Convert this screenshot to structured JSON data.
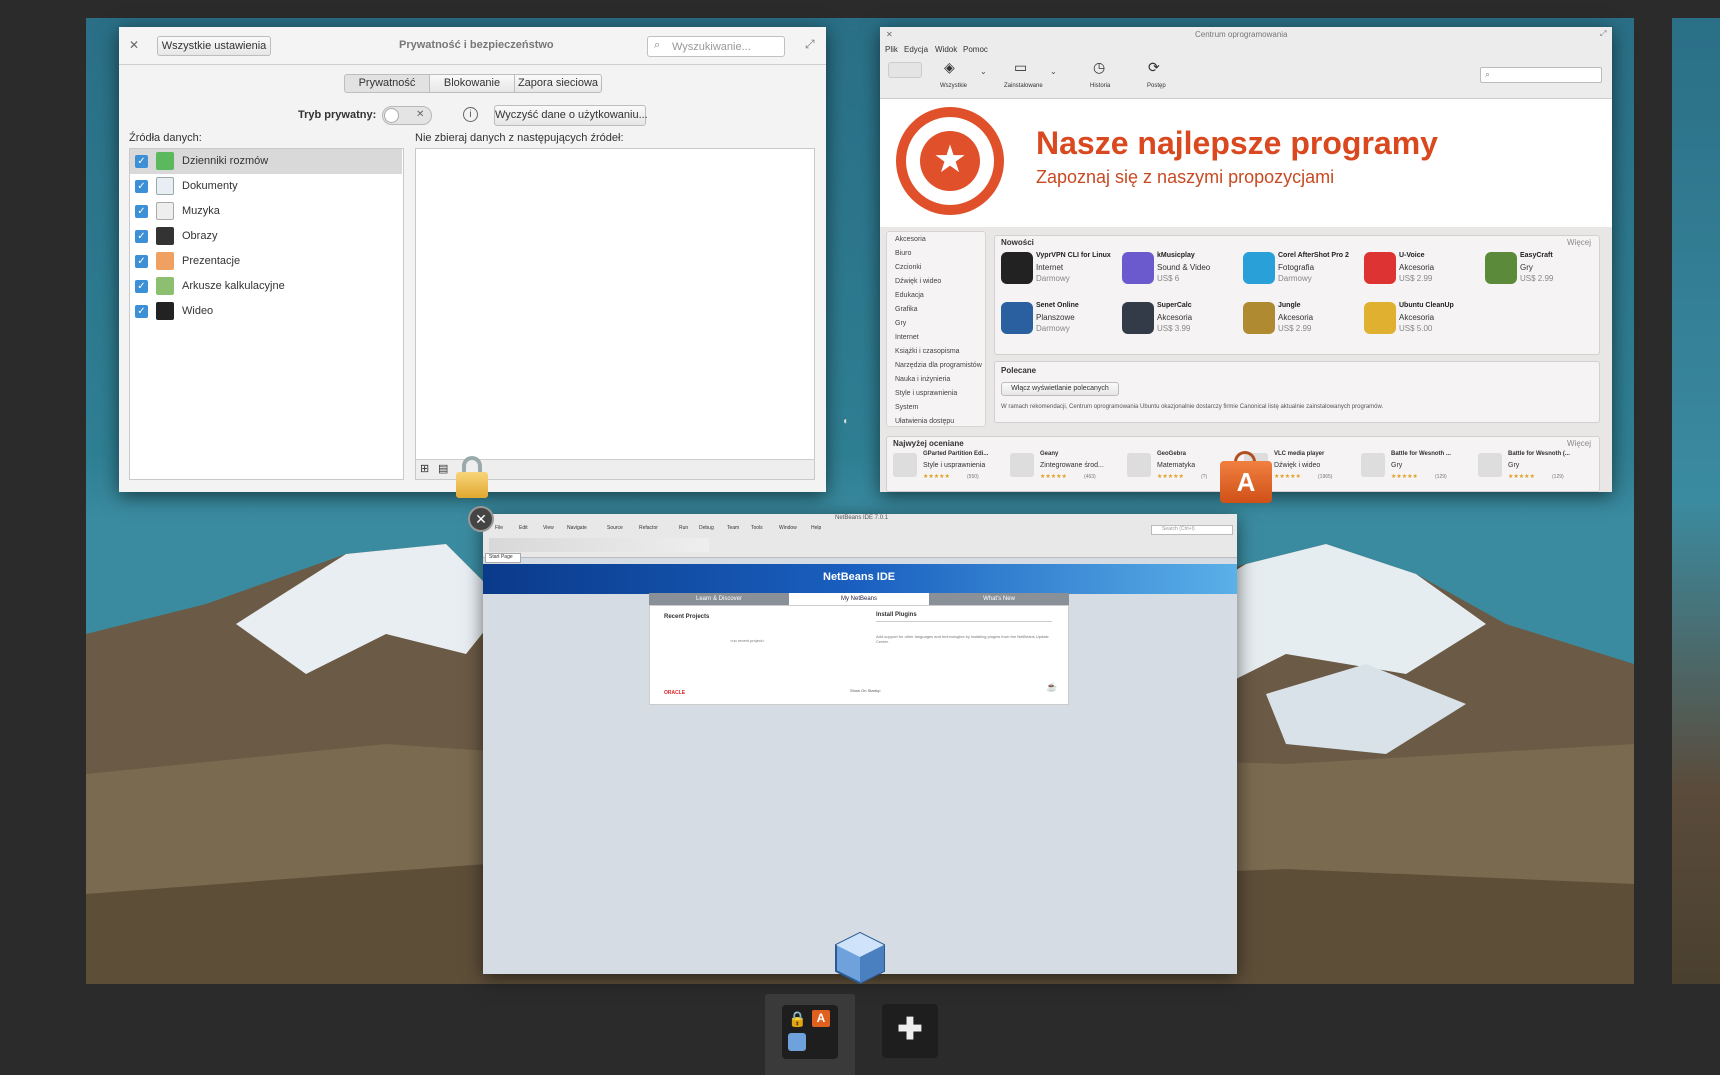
{
  "privacy_window": {
    "title": "Prywatność i bezpieczeństwo",
    "back_label": "Wszystkie ustawienia",
    "search_placeholder": "Wyszukiwanie...",
    "tabs": [
      "Prywatność",
      "Blokowanie",
      "Zapora sieciowa"
    ],
    "private_mode_label": "Tryb prywatny:",
    "clear_label": "Wyczyść dane o użytkowaniu...",
    "sources_label": "Źródła danych:",
    "exclude_label": "Nie zbieraj danych z następujących źródeł:",
    "sources": [
      "Dzienniki rozmów",
      "Dokumenty",
      "Muzyka",
      "Obrazy",
      "Prezentacje",
      "Arkusze kalkulacyjne",
      "Wideo"
    ]
  },
  "software_center": {
    "title": "Centrum oprogramowania",
    "menu": [
      "Plik",
      "Edycja",
      "Widok",
      "Pomoc"
    ],
    "toolbar": [
      "Wszystkie",
      "Zainstalowane",
      "Historia",
      "Postęp"
    ],
    "banner_title": "Nasze najlepsze programy",
    "banner_subtitle": "Zapoznaj się z naszymi propozycjami",
    "categories": [
      "Akcesoria",
      "Biuro",
      "Czcionki",
      "Dźwięk i wideo",
      "Edukacja",
      "Grafika",
      "Gry",
      "Internet",
      "Książki i czasopisma",
      "Narzędzia dla programistów",
      "Nauka i inżynieria",
      "Style i usprawnienia",
      "System",
      "Ułatwienia dostępu"
    ],
    "new_heading": "Nowości",
    "more": "Więcej",
    "new_apps": [
      {
        "name": "VyprVPN CLI for Linux",
        "cat": "Internet",
        "price": "Darmowy",
        "color": "#222"
      },
      {
        "name": "kMusicplay",
        "cat": "Sound & Video",
        "price": "US$ 6",
        "color": "#6a5acd"
      },
      {
        "name": "Corel AfterShot Pro 2",
        "cat": "Fotografia",
        "price": "Darmowy",
        "color": "#2aa0d8"
      },
      {
        "name": "U-Voice",
        "cat": "Akcesoria",
        "price": "US$ 2.99",
        "color": "#d33"
      },
      {
        "name": "EasyCraft",
        "cat": "Gry",
        "price": "US$ 2.99",
        "color": "#5a8a3a"
      },
      {
        "name": "Senet Online",
        "cat": "Planszowe",
        "price": "Darmowy",
        "color": "#2a5fa0"
      },
      {
        "name": "SuperCalc",
        "cat": "Akcesoria",
        "price": "US$ 3.99",
        "color": "#333a48"
      },
      {
        "name": "Jungle",
        "cat": "Akcesoria",
        "price": "US$ 2.99",
        "color": "#b08a30"
      },
      {
        "name": "Ubuntu CleanUp",
        "cat": "Akcesoria",
        "price": "US$ 5.00",
        "color": "#e0b030"
      }
    ],
    "recommended_heading": "Polecane",
    "recommended_button": "Włącz wyświetlanie polecanych",
    "recommended_text": "W ramach rekomendacji, Centrum oprogramowania Ubuntu okazjonalnie dostarczy firmie Canonical listę aktualnie zainstalowanych programów.",
    "top_heading": "Najwyżej oceniane",
    "top_apps": [
      {
        "name": "GParted Partition Edi...",
        "cat": "Style i usprawnienia",
        "count": "(550)"
      },
      {
        "name": "Geany",
        "cat": "Zintegrowane środ...",
        "count": "(463)"
      },
      {
        "name": "GeoGebra",
        "cat": "Matematyka",
        "count": "(?)"
      },
      {
        "name": "VLC media player",
        "cat": "Dźwięk i wideo",
        "count": "(1965)"
      },
      {
        "name": "Battle for Wesnoth ...",
        "cat": "Gry",
        "count": "(129)"
      },
      {
        "name": "Battle for Wesnoth (...",
        "cat": "Gry",
        "count": "(129)"
      }
    ]
  },
  "netbeans": {
    "title": "NetBeans IDE 7.0.1",
    "menu": [
      "File",
      "Edit",
      "View",
      "Navigate",
      "Source",
      "Refactor",
      "Run",
      "Debug",
      "Team",
      "Tools",
      "Window",
      "Help"
    ],
    "search_placeholder": "Search (Ctrl+I)",
    "tab": "Start Page",
    "logo": "NetBeans IDE",
    "tabs": [
      "Learn & Discover",
      "My NetBeans",
      "What's New"
    ],
    "recent_heading": "Recent Projects",
    "no_recent": "<no recent project>",
    "plugins_heading": "Install Plugins",
    "plugins_text": "Add support for other languages and technologies by installing plugins from the NetBeans Update Center.",
    "oracle": "ORACLE",
    "show_on_startup": "Show On Startup"
  }
}
